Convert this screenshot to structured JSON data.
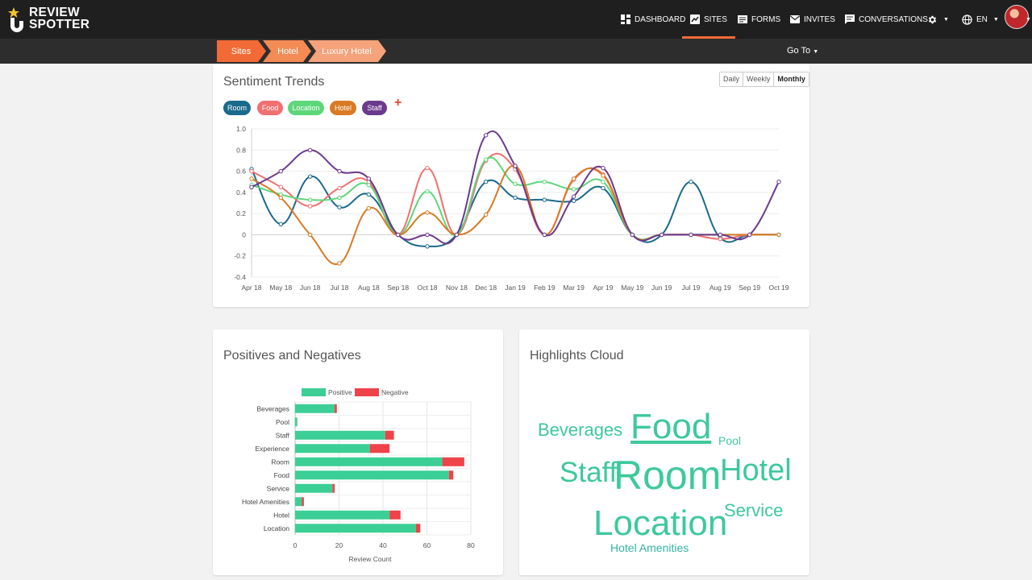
{
  "brand": {
    "line1": "REVIEW",
    "line2": "SPOTTER"
  },
  "nav": {
    "dashboard": "DASHBOARD",
    "sites": "SITES",
    "forms": "FORMS",
    "invites": "INVITES",
    "conversations": "CONVERSATIONS",
    "lang": "EN",
    "active": "sites"
  },
  "breadcrumb": [
    "Sites",
    "Hotel",
    "Luxury Hotel"
  ],
  "goto_label": "Go To",
  "colors": {
    "accent": "#f26a35",
    "room": "#1a6a8c",
    "food": "#f07070",
    "location": "#5ed67a",
    "hotel": "#d97a25",
    "staff": "#6b3a8e",
    "positive": "#3ccf95",
    "negative": "#ef4249",
    "cloud": "#3ec99a"
  },
  "sentiment": {
    "title": "Sentiment Trends",
    "periods": [
      "Daily",
      "Weekly",
      "Monthly"
    ],
    "selected_period": "Monthly",
    "filters": [
      "Room",
      "Food",
      "Location",
      "Hotel",
      "Staff"
    ]
  },
  "posneg": {
    "title": "Positives and Negatives"
  },
  "highlights": {
    "title": "Highlights Cloud",
    "words": [
      {
        "text": "Beverages",
        "weight": 3
      },
      {
        "text": "Food",
        "weight": 5
      },
      {
        "text": "Pool",
        "weight": 1
      },
      {
        "text": "Staff",
        "weight": 4
      },
      {
        "text": "Room",
        "weight": 6
      },
      {
        "text": "Hotel",
        "weight": 5
      },
      {
        "text": "Location",
        "weight": 6
      },
      {
        "text": "Service",
        "weight": 3
      },
      {
        "text": "Hotel Amenities",
        "weight": 2
      }
    ]
  },
  "chart_data": [
    {
      "type": "line",
      "title": "Sentiment Trends",
      "x": [
        "Apr 18",
        "May 18",
        "Jun 18",
        "Jul 18",
        "Aug 18",
        "Sep 18",
        "Oct 18",
        "Nov 18",
        "Dec 18",
        "Jan 19",
        "Feb 19",
        "Mar 19",
        "Apr 19",
        "May 19",
        "Jun 19",
        "Jul 19",
        "Aug 19",
        "Sep 19",
        "Oct 19"
      ],
      "ylim": [
        -0.4,
        1.0
      ],
      "yticks": [
        "1.0",
        "0.8",
        "0.6",
        "0.4",
        "0.2",
        "0",
        "-0.2",
        "-0.4"
      ],
      "grid": true,
      "series": [
        {
          "name": "Room",
          "values": [
            0.62,
            0.1,
            0.55,
            0.26,
            0.38,
            0.0,
            -0.11,
            0.0,
            0.5,
            0.35,
            0.33,
            0.32,
            0.44,
            0.0,
            0.0,
            0.5,
            -0.03,
            0.0,
            0.0
          ]
        },
        {
          "name": "Food",
          "values": [
            0.6,
            0.45,
            0.27,
            0.44,
            0.5,
            0.0,
            0.63,
            0.0,
            0.7,
            0.62,
            0.0,
            0.52,
            0.57,
            0.0,
            0.0,
            0.0,
            -0.04,
            0.0,
            0.0
          ]
        },
        {
          "name": "Location",
          "values": [
            0.47,
            0.38,
            0.33,
            0.35,
            0.47,
            0.0,
            0.41,
            0.0,
            0.71,
            0.48,
            0.5,
            0.43,
            0.5,
            0.0,
            0.0,
            0.0,
            0.0,
            0.0,
            0.0
          ]
        },
        {
          "name": "Hotel",
          "values": [
            0.53,
            0.35,
            0.0,
            -0.27,
            0.25,
            0.0,
            0.21,
            0.0,
            0.19,
            0.65,
            0.0,
            0.53,
            0.56,
            0.0,
            0.0,
            0.0,
            0.0,
            0.0,
            0.0
          ]
        },
        {
          "name": "Staff",
          "values": [
            0.45,
            0.6,
            0.8,
            0.6,
            0.53,
            0.0,
            0.0,
            0.0,
            0.94,
            0.65,
            0.0,
            0.36,
            0.63,
            0.0,
            0.0,
            0.0,
            0.0,
            0.0,
            0.5
          ]
        }
      ]
    },
    {
      "type": "bar",
      "orientation": "horizontal",
      "stacked": true,
      "categories": [
        "Beverages",
        "Pool",
        "Staff",
        "Experience",
        "Room",
        "Food",
        "Service",
        "Hotel Amenities",
        "Hotel",
        "Location"
      ],
      "series": [
        {
          "name": "Positive",
          "values": [
            18,
            1,
            41,
            34,
            67,
            70,
            17,
            3,
            43,
            55
          ]
        },
        {
          "name": "Negative",
          "values": [
            1,
            0,
            4,
            9,
            10,
            2,
            1,
            1,
            5,
            2
          ]
        }
      ],
      "xlabel": "Review Count",
      "xlim": [
        0,
        80
      ],
      "xticks": [
        "0",
        "20",
        "40",
        "60",
        "80"
      ],
      "legend": "top",
      "grid": true
    }
  ]
}
